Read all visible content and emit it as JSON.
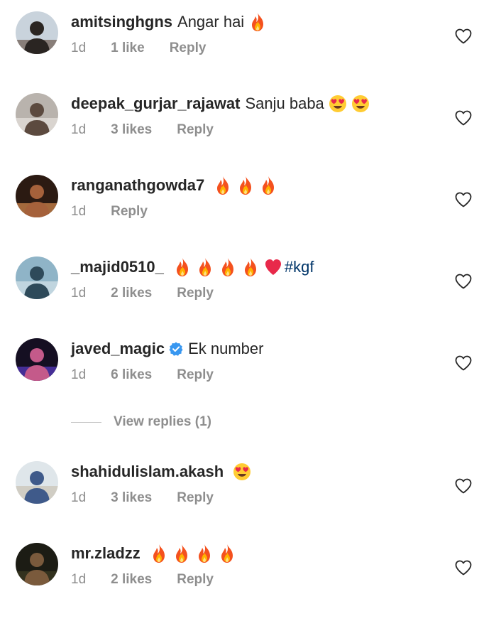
{
  "comments": [
    {
      "username": "amitsinghgns",
      "text": "Angar hai",
      "emojis": [
        "fire"
      ],
      "hashtag": "",
      "verified": false,
      "time": "1d",
      "likes": "1 like",
      "reply": "Reply",
      "avatar_colors": {
        "bg": "#c9d3dc",
        "fg": "#2a2522",
        "accent": "#6c5a4e"
      }
    },
    {
      "username": "deepak_gurjar_rajawat",
      "text": "Sanju baba",
      "emojis": [
        "heart-eyes",
        "heart-eyes"
      ],
      "hashtag": "",
      "verified": false,
      "time": "1d",
      "likes": "3 likes",
      "reply": "Reply",
      "avatar_colors": {
        "bg": "#b9b3ad",
        "fg": "#5c4a3f",
        "accent": "#e7e2dd"
      }
    },
    {
      "username": "ranganathgowda7",
      "text": "",
      "emojis": [
        "fire",
        "fire",
        "fire"
      ],
      "hashtag": "",
      "verified": false,
      "time": "1d",
      "likes": "",
      "reply": "Reply",
      "avatar_colors": {
        "bg": "#2b1a12",
        "fg": "#a5613b",
        "accent": "#d88c4f"
      }
    },
    {
      "username": "_majid0510_",
      "text": "",
      "emojis": [
        "fire",
        "fire",
        "fire",
        "fire",
        "red-heart"
      ],
      "hashtag": "#kgf",
      "verified": false,
      "time": "1d",
      "likes": "2 likes",
      "reply": "Reply",
      "avatar_colors": {
        "bg": "#8fb4c7",
        "fg": "#2e4a5a",
        "accent": "#d4e3ea"
      }
    },
    {
      "username": "javed_magic",
      "text": "Ek number",
      "emojis": [],
      "hashtag": "",
      "verified": true,
      "time": "1d",
      "likes": "6 likes",
      "reply": "Reply",
      "avatar_colors": {
        "bg": "#150f22",
        "fg": "#c45a8a",
        "accent": "#5a3cc8"
      }
    },
    {
      "username": "shahidulislam.akash",
      "text": "",
      "emojis": [
        "heart-eyes"
      ],
      "hashtag": "",
      "verified": false,
      "time": "1d",
      "likes": "3 likes",
      "reply": "Reply",
      "avatar_colors": {
        "bg": "#dfe6ea",
        "fg": "#3f5a8a",
        "accent": "#c9c2b4"
      }
    },
    {
      "username": "mr.zladzz",
      "text": "",
      "emojis": [
        "fire",
        "fire",
        "fire",
        "fire"
      ],
      "hashtag": "",
      "verified": false,
      "time": "1d",
      "likes": "2 likes",
      "reply": "Reply",
      "avatar_colors": {
        "bg": "#1c1c14",
        "fg": "#7a5a3c",
        "accent": "#3c3a22"
      }
    }
  ],
  "view_replies": {
    "label": "View replies (1)"
  },
  "icons": {
    "like": "heart-outline-icon",
    "verified": "verified-badge-icon",
    "fire": "fire-emoji-icon",
    "heart_eyes": "heart-eyes-emoji-icon",
    "red_heart": "red-heart-emoji-icon"
  },
  "colors": {
    "text": "#262626",
    "meta": "#8e8e8e",
    "hashtag": "#003569",
    "verified": "#3897f0"
  }
}
